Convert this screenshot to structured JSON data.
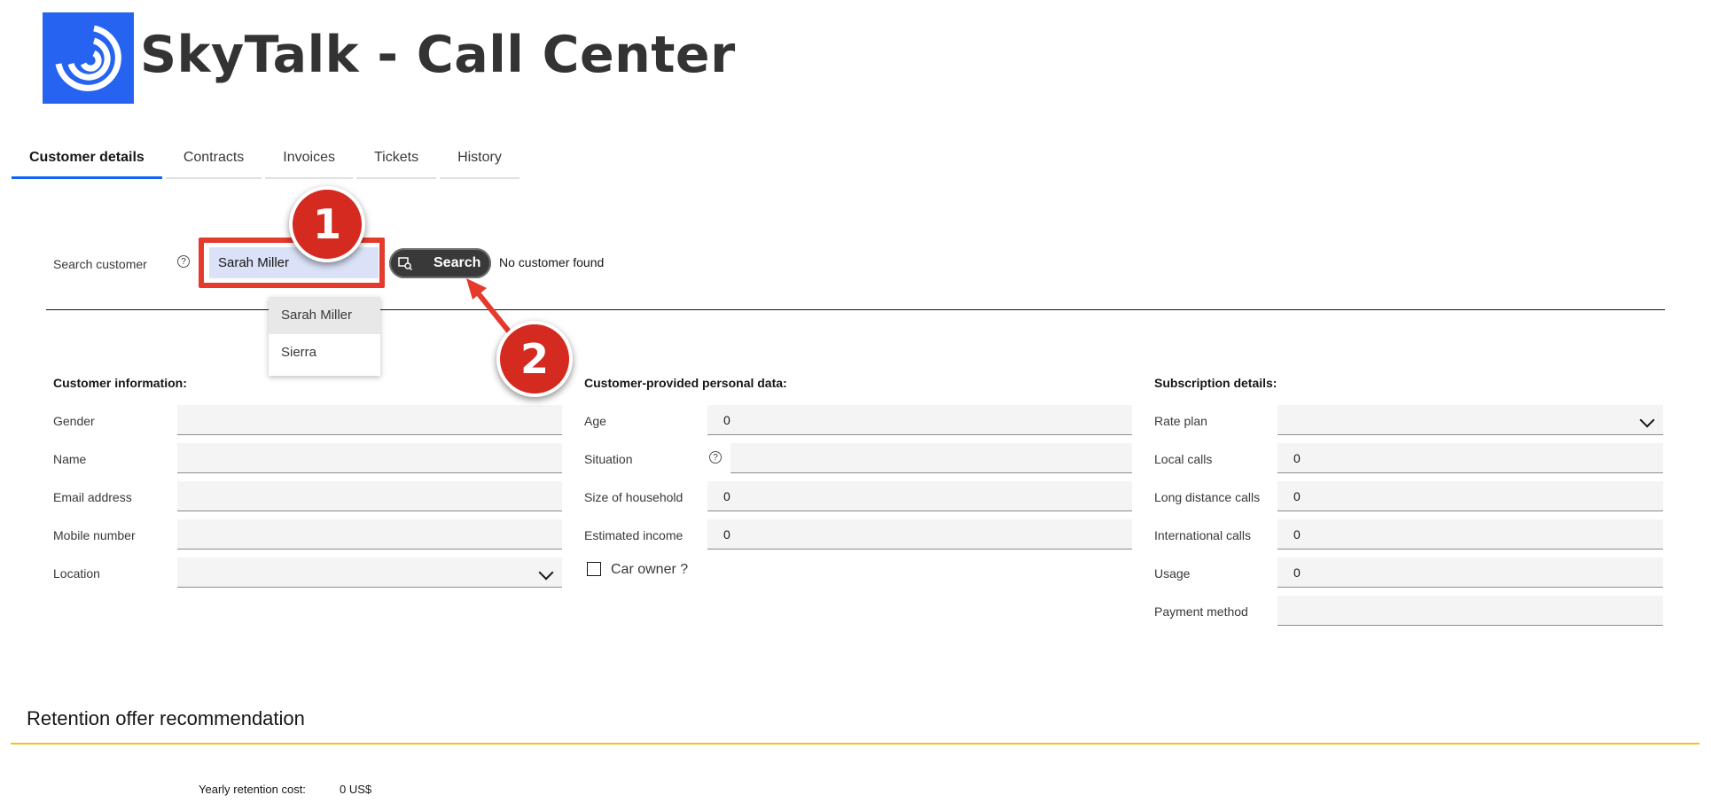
{
  "header": {
    "title": "SkyTalk - Call Center",
    "logo_icon": "skytalk-logo-icon",
    "brand_color": "#2563f0"
  },
  "tabs": [
    {
      "label": "Customer details",
      "active": true
    },
    {
      "label": "Contracts"
    },
    {
      "label": "Invoices"
    },
    {
      "label": "Tickets"
    },
    {
      "label": "History"
    }
  ],
  "search": {
    "label": "Search customer",
    "help_icon": "?",
    "value": "Sarah Miller",
    "button_label": "Search",
    "status": "No customer found",
    "suggestions": [
      "Sarah Miller",
      "Sierra"
    ]
  },
  "annotations": {
    "badge1": "1",
    "badge2": "2",
    "color": "#d42a1f"
  },
  "customer_info": {
    "title": "Customer information:",
    "fields": [
      {
        "label": "Gender",
        "value": ""
      },
      {
        "label": "Name",
        "value": ""
      },
      {
        "label": "Email address",
        "value": ""
      },
      {
        "label": "Mobile number",
        "value": ""
      },
      {
        "label": "Location",
        "value": ""
      }
    ]
  },
  "personal_data": {
    "title": "Customer-provided personal data:",
    "fields": [
      {
        "label": "Age",
        "value": "0"
      },
      {
        "label": "Situation",
        "value": ""
      },
      {
        "label": "Size of household",
        "value": "0"
      },
      {
        "label": "Estimated income",
        "value": "0"
      }
    ],
    "car_owner_label": "Car owner ?"
  },
  "subscription": {
    "title": "Subscription details:",
    "fields": [
      {
        "label": "Rate plan",
        "value": ""
      },
      {
        "label": "Local calls",
        "value": "0"
      },
      {
        "label": "Long distance calls",
        "value": "0"
      },
      {
        "label": "International calls",
        "value": "0"
      },
      {
        "label": "Usage",
        "value": "0"
      },
      {
        "label": "Payment method",
        "value": ""
      }
    ]
  },
  "retention": {
    "title": "Retention offer recommendation",
    "cost_label": "Yearly retention cost:",
    "cost_value": "0  US$"
  }
}
